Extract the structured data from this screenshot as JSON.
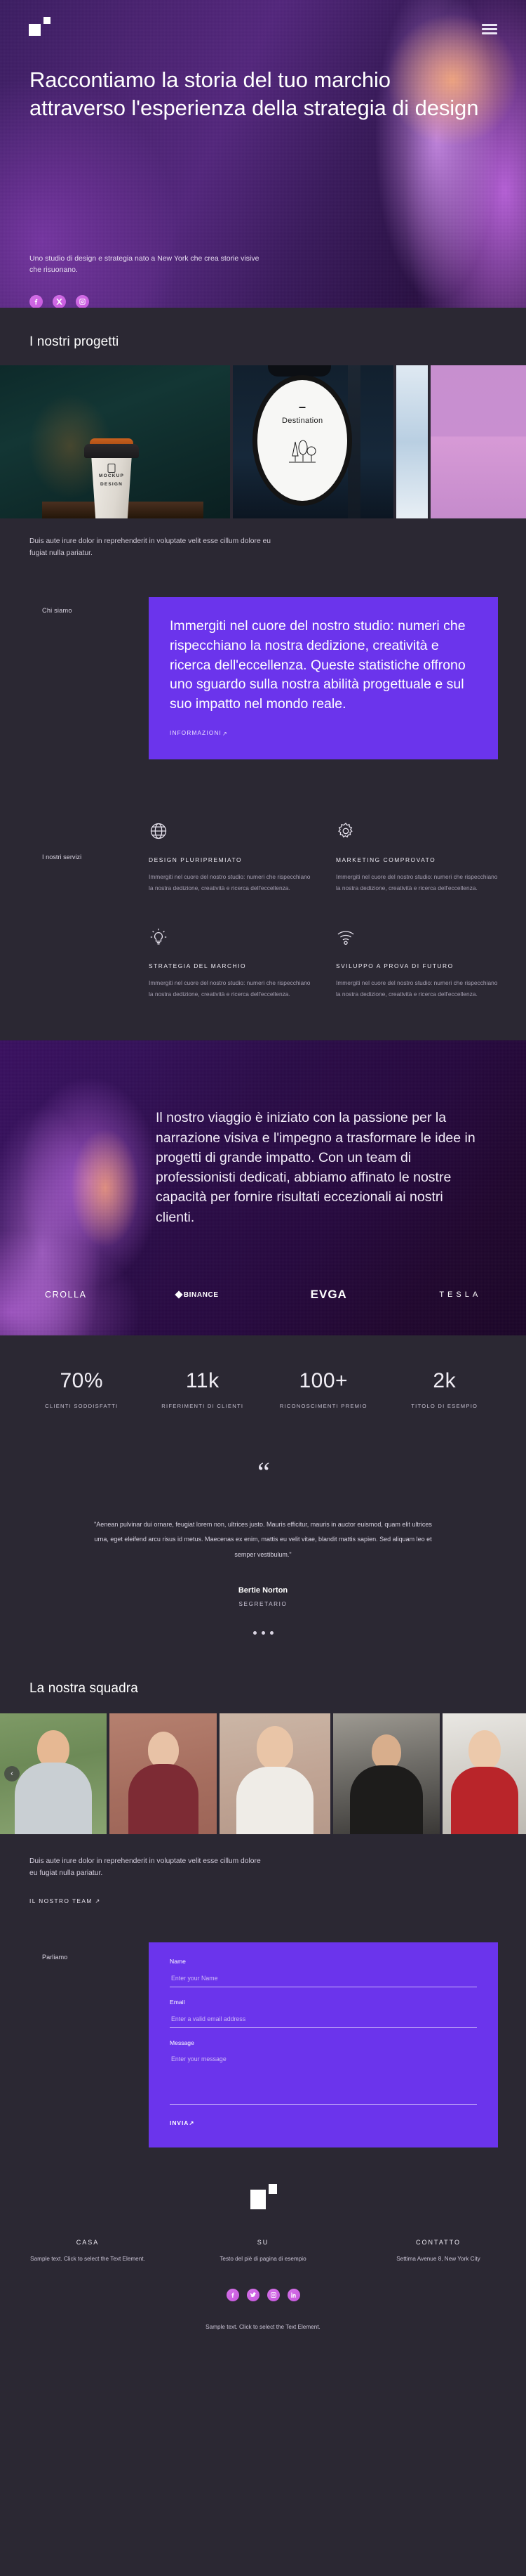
{
  "hero": {
    "logo": "logo-mark",
    "menu_label": "menu",
    "title": "Raccontiamo la storia del tuo marchio attraverso l'esperienza della strategia di design",
    "subtitle": "Uno studio di design e strategia nato a New York che crea storie visive che risuonano.",
    "social": [
      {
        "name": "facebook",
        "label": "f"
      },
      {
        "name": "x-twitter",
        "label": "X"
      },
      {
        "name": "instagram",
        "label": "ig"
      }
    ]
  },
  "projects": {
    "heading": "I nostri progetti",
    "cards": [
      {
        "name": "coffee-cup-mockup",
        "line1": "MOCKUP",
        "line2": "DESIGN",
        "dots": "• • • •"
      },
      {
        "name": "destination-sign",
        "label": "Destination"
      },
      {
        "name": "window-light"
      },
      {
        "name": "pink-fabric"
      }
    ],
    "lorem": "Duis aute irure dolor in reprehenderit in voluptate velit esse cillum dolore eu fugiat nulla pariatur."
  },
  "about": {
    "eyebrow": "Chi siamo",
    "text": "Immergiti nel cuore del nostro studio: numeri che rispecchiano la nostra dedizione, creatività e ricerca dell'eccellenza. Queste statistiche offrono uno sguardo sulla nostra abilità progettuale e sul suo impatto nel mondo reale.",
    "link": "INFORMAZIONI",
    "link_arrow": "↗"
  },
  "services": {
    "eyebrow": "I nostri servizi",
    "items": [
      {
        "icon": "globe-icon",
        "title": "DESIGN PLURIPREMIATO",
        "body": "Immergiti nel cuore del nostro studio: numeri che rispecchiano la nostra dedizione, creatività e ricerca dell'eccellenza."
      },
      {
        "icon": "gear-icon",
        "title": "MARKETING COMPROVATO",
        "body": "Immergiti nel cuore del nostro studio: numeri che rispecchiano la nostra dedizione, creatività e ricerca dell'eccellenza."
      },
      {
        "icon": "lightbulb-icon",
        "title": "STRATEGIA DEL MARCHIO",
        "body": "Immergiti nel cuore del nostro studio: numeri che rispecchiano la nostra dedizione, creatività e ricerca dell'eccellenza."
      },
      {
        "icon": "wifi-icon",
        "title": "SVILUPPO A PROVA DI FUTURO",
        "body": "Immergiti nel cuore del nostro studio: numeri che rispecchiano la nostra dedizione, creatività e ricerca dell'eccellenza."
      }
    ]
  },
  "journey": {
    "text": "Il nostro viaggio è iniziato con la passione per la narrazione visiva e l'impegno a trasformare le idee in progetti di grande impatto. Con un team di professionisti dedicati, abbiamo affinato le nostre capacità per fornire risultati eccezionali ai nostri clienti.",
    "brands": [
      {
        "name": "crolla",
        "label": "CROLLA"
      },
      {
        "name": "binance",
        "label": "BINANCE"
      },
      {
        "name": "evga",
        "label": "EVGA"
      },
      {
        "name": "tesla",
        "label": "TESLA"
      }
    ]
  },
  "stats": [
    {
      "value": "70%",
      "label": "CLIENTI SODDISFATTI"
    },
    {
      "value": "11k",
      "label": "RIFERIMENTI DI CLIENTI"
    },
    {
      "value": "100+",
      "label": "RICONOSCIMENTI PREMIO"
    },
    {
      "value": "2k",
      "label": "TITOLO DI ESEMPIO"
    }
  ],
  "testimonial": {
    "quote_icon": "quote-icon",
    "text": "\"Aenean pulvinar dui ornare, feugiat lorem non, ultrices justo. Mauris efficitur, mauris in auctor euismod, quam elit ultrices urna, eget eleifend arcu risus id metus. Maecenas ex enim, mattis eu velit vitae, blandit mattis sapien. Sed aliquam leo et semper vestibulum.\"",
    "name": "Bertie Norton",
    "role": "SEGRETARIO"
  },
  "team": {
    "heading": "La nostra squadra",
    "prev_label": "‹",
    "text": "Duis aute irure dolor in reprehenderit in voluptate velit esse cillum dolore eu fugiat nulla pariatur.",
    "link": "IL NOSTRO TEAM ↗"
  },
  "contact": {
    "eyebrow": "Parliamo",
    "name_label": "Name",
    "name_placeholder": "Enter your Name",
    "name_value": "",
    "email_label": "Email",
    "email_placeholder": "Enter a valid email address",
    "email_value": "",
    "message_label": "Message",
    "message_placeholder": "Enter your message",
    "message_value": "",
    "submit": "INVIA↗"
  },
  "footer": {
    "columns": [
      {
        "title": "CASA",
        "text": "Sample text. Click to select the Text Element."
      },
      {
        "title": "SU",
        "text": "Testo del piè di pagina di esempio"
      },
      {
        "title": "CONTATTO",
        "text": "Settima Avenue 8, New York City"
      }
    ],
    "social": [
      {
        "name": "facebook"
      },
      {
        "name": "twitter"
      },
      {
        "name": "instagram"
      },
      {
        "name": "linkedin"
      }
    ],
    "copyright": "Sample text. Click to select the Text Element."
  },
  "colors": {
    "page_bg": "#2b2833",
    "accent_purple": "#6b34ec",
    "social_pink": "#cf63e0",
    "hero_purple": "#4a2270"
  }
}
